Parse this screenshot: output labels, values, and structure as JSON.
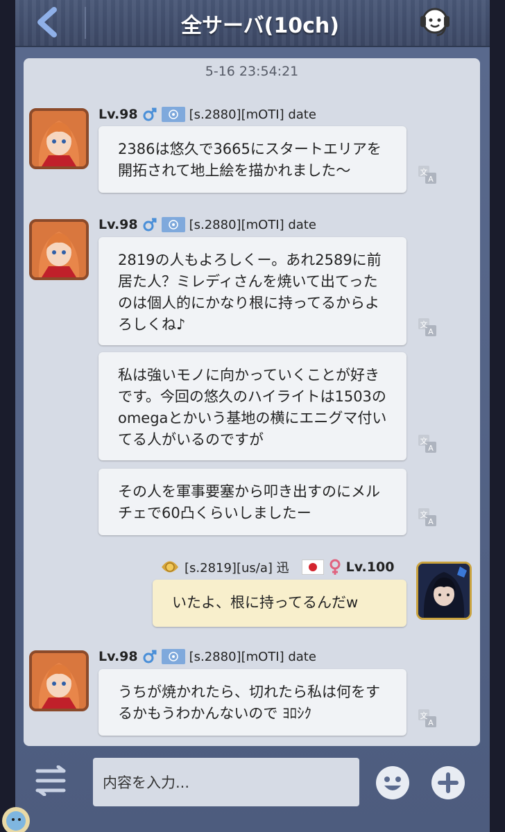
{
  "header": {
    "title": "全サーバ(10ch)"
  },
  "chat": {
    "timestamp": "5-16 23:54:21",
    "messages": [
      {
        "level": "Lv.98",
        "sender": "[s.2880][mOTI] date",
        "lines": [
          "2386は悠久で3665にスタートエリアを",
          "開拓されて地上絵を描かれました〜"
        ]
      },
      {
        "level": "Lv.98",
        "sender": "[s.2880][mOTI] date",
        "lines": [
          "2819の人もよろしくー。あれ2589に前",
          "居た人？ミレディさんを焼いて出てった",
          "のは個人的にかなり根に持ってるからよ",
          "ろしくね♪"
        ]
      },
      {
        "lines": [
          "私は強いモノに向かっていくことが好き",
          "です。今回の悠久のハイライトは1503の",
          "omegaとかいう基地の横にエニグマ付い",
          "てる人がいるのですが"
        ]
      },
      {
        "lines": [
          "その人を軍事要塞から叩き出すのにメル",
          "チェで60凸くらいしましたー"
        ]
      },
      {
        "level": "Lv.100",
        "sender": "[s.2819][us/a] 迅",
        "lines": [
          "いたよ、根に持ってるんだw"
        ]
      },
      {
        "level": "Lv.98",
        "sender": "[s.2880][mOTI] date",
        "lines": [
          "うちが焼かれたら、切れたら私は何をす",
          "るかもうわかんないので ﾖﾛｼｸ"
        ]
      }
    ]
  },
  "input": {
    "placeholder": "内容を入力..."
  },
  "icons": {
    "back": "chevron-left-icon",
    "support": "headset-icon",
    "male": "male-icon",
    "female": "female-icon",
    "translate": "translate-icon",
    "menu": "swap-list-icon",
    "emoji": "smiley-icon",
    "plus": "plus-icon"
  },
  "colors": {
    "bubble_self": "#f8efcc",
    "bubble_other": "#f1f3f6",
    "panel": "#d6dbe5",
    "frame": "#56668a"
  }
}
